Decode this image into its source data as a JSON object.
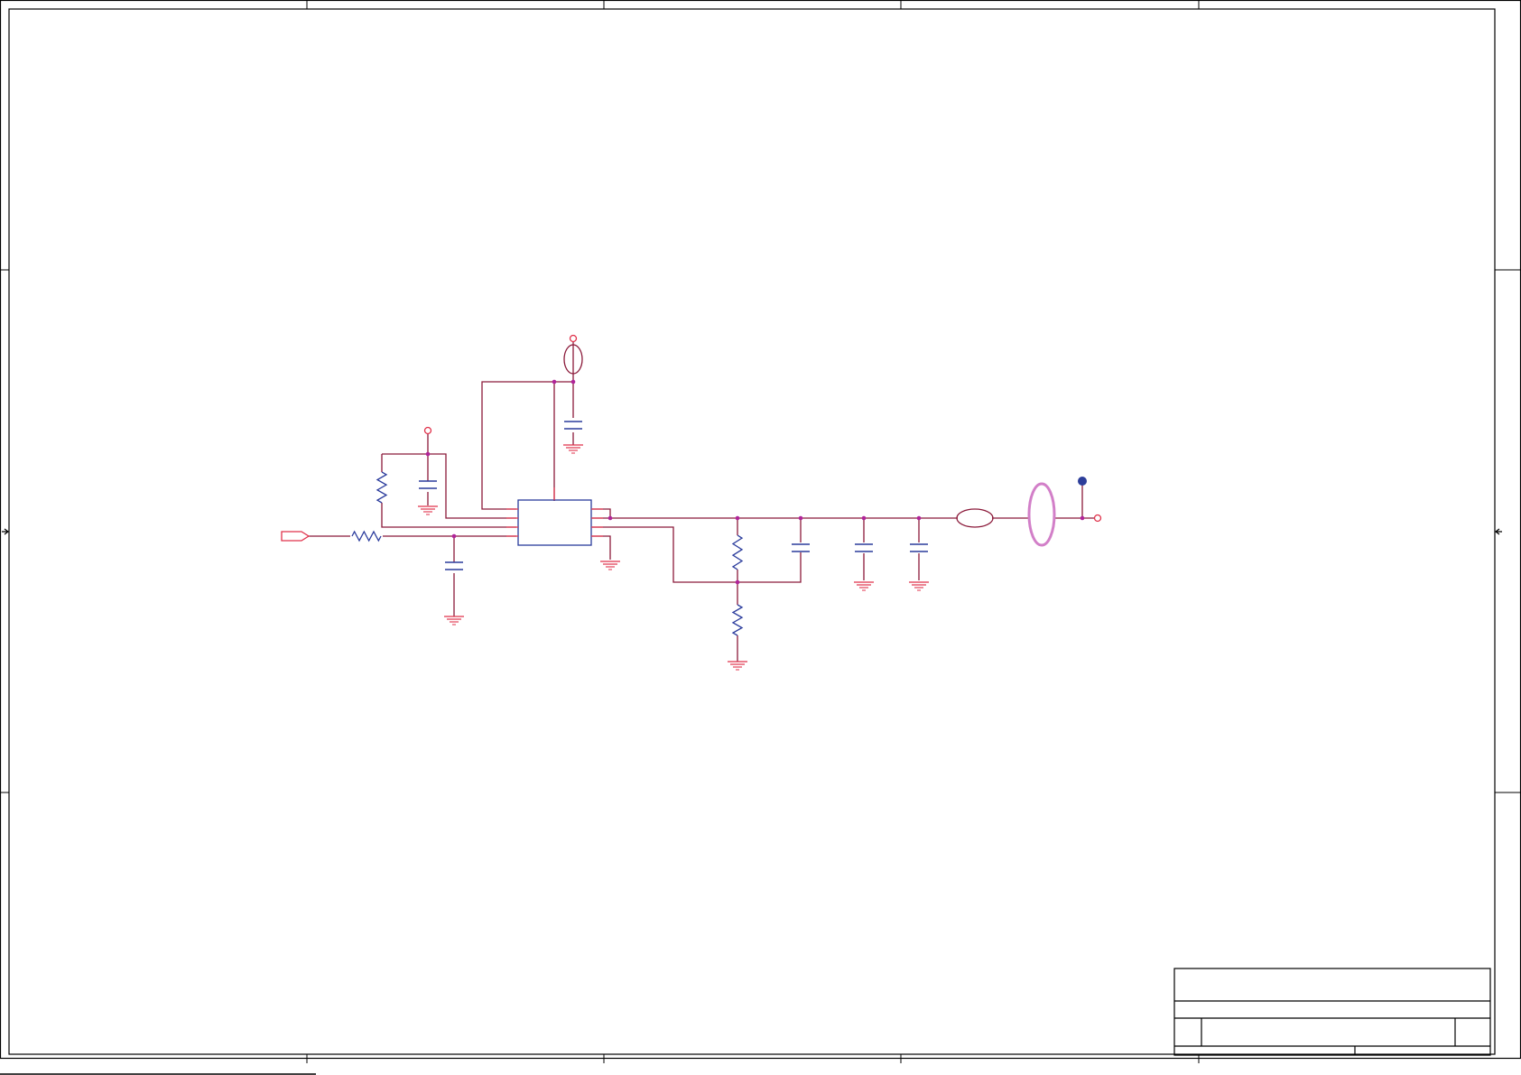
{
  "colors": {
    "wire": "#8b1a3a",
    "pin": "#e0324b",
    "component": "#2a3b9c",
    "junction": "#b0249a",
    "port": "#e0324b",
    "frame": "#000000",
    "ferrite": "#d27fc8",
    "testpoint": "#2d3e9a"
  },
  "components": [
    {
      "type": "ic",
      "name": "regulator-ic"
    },
    {
      "type": "resistor",
      "name": "input-series-resistor"
    },
    {
      "type": "resistor",
      "name": "enable-pullup-resistor"
    },
    {
      "type": "resistor",
      "name": "feedback-top-resistor"
    },
    {
      "type": "resistor",
      "name": "feedback-bottom-resistor"
    },
    {
      "type": "capacitor",
      "name": "input-filter-capacitor"
    },
    {
      "type": "capacitor",
      "name": "pullup-decoupling-capacitor"
    },
    {
      "type": "capacitor",
      "name": "supply-decoupling-capacitor"
    },
    {
      "type": "capacitor",
      "name": "feedforward-capacitor"
    },
    {
      "type": "capacitor",
      "name": "output-capacitor-1"
    },
    {
      "type": "capacitor",
      "name": "output-capacitor-2"
    },
    {
      "type": "ferrite-bead",
      "name": "supply-ferrite"
    },
    {
      "type": "ferrite-bead",
      "name": "output-ferrite"
    },
    {
      "type": "inductor-loop",
      "name": "output-choke"
    },
    {
      "type": "test-point",
      "name": "output-test-point"
    },
    {
      "type": "power-port",
      "name": "supply-power-port"
    },
    {
      "type": "power-port",
      "name": "pullup-power-port"
    },
    {
      "type": "power-port",
      "name": "output-power-port"
    },
    {
      "type": "offsheet-connector",
      "name": "input-offsheet-port"
    }
  ]
}
